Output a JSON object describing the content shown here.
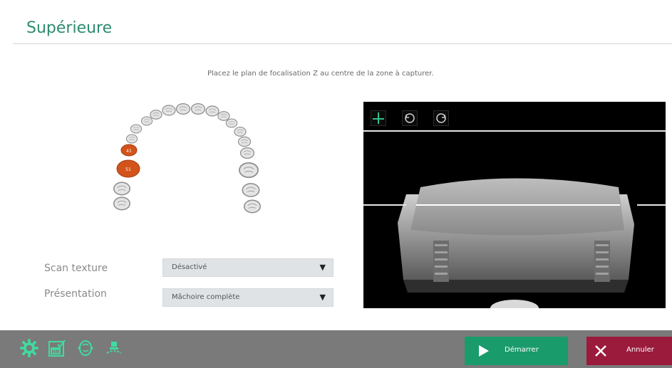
{
  "header": {
    "title": "Supérieure"
  },
  "instruction": "Placez le plan de focalisation Z au centre de la zone à capturer.",
  "tooth_chart": {
    "selected_teeth": [
      {
        "label": "41"
      },
      {
        "label": "51"
      }
    ],
    "selected_color": "#d2541b"
  },
  "settings": {
    "scan_texture": {
      "label": "Scan texture",
      "value": "Désactivé"
    },
    "presentation": {
      "label": "Présentation",
      "value": "Mâchoire complète"
    }
  },
  "camera": {
    "buttons": [
      "focus-plane-icon",
      "rotate-left-icon",
      "rotate-right-icon"
    ]
  },
  "toolbar": {
    "icons": [
      "gear-icon",
      "hr-icon",
      "tooth-icon",
      "scanner-icon"
    ],
    "start_label": "Démarrer",
    "cancel_label": "Annuler"
  },
  "colors": {
    "accent": "#2e8b6e",
    "start": "#1a9b6c",
    "cancel": "#9b1b3d",
    "toolbar": "#7a7a7a"
  }
}
